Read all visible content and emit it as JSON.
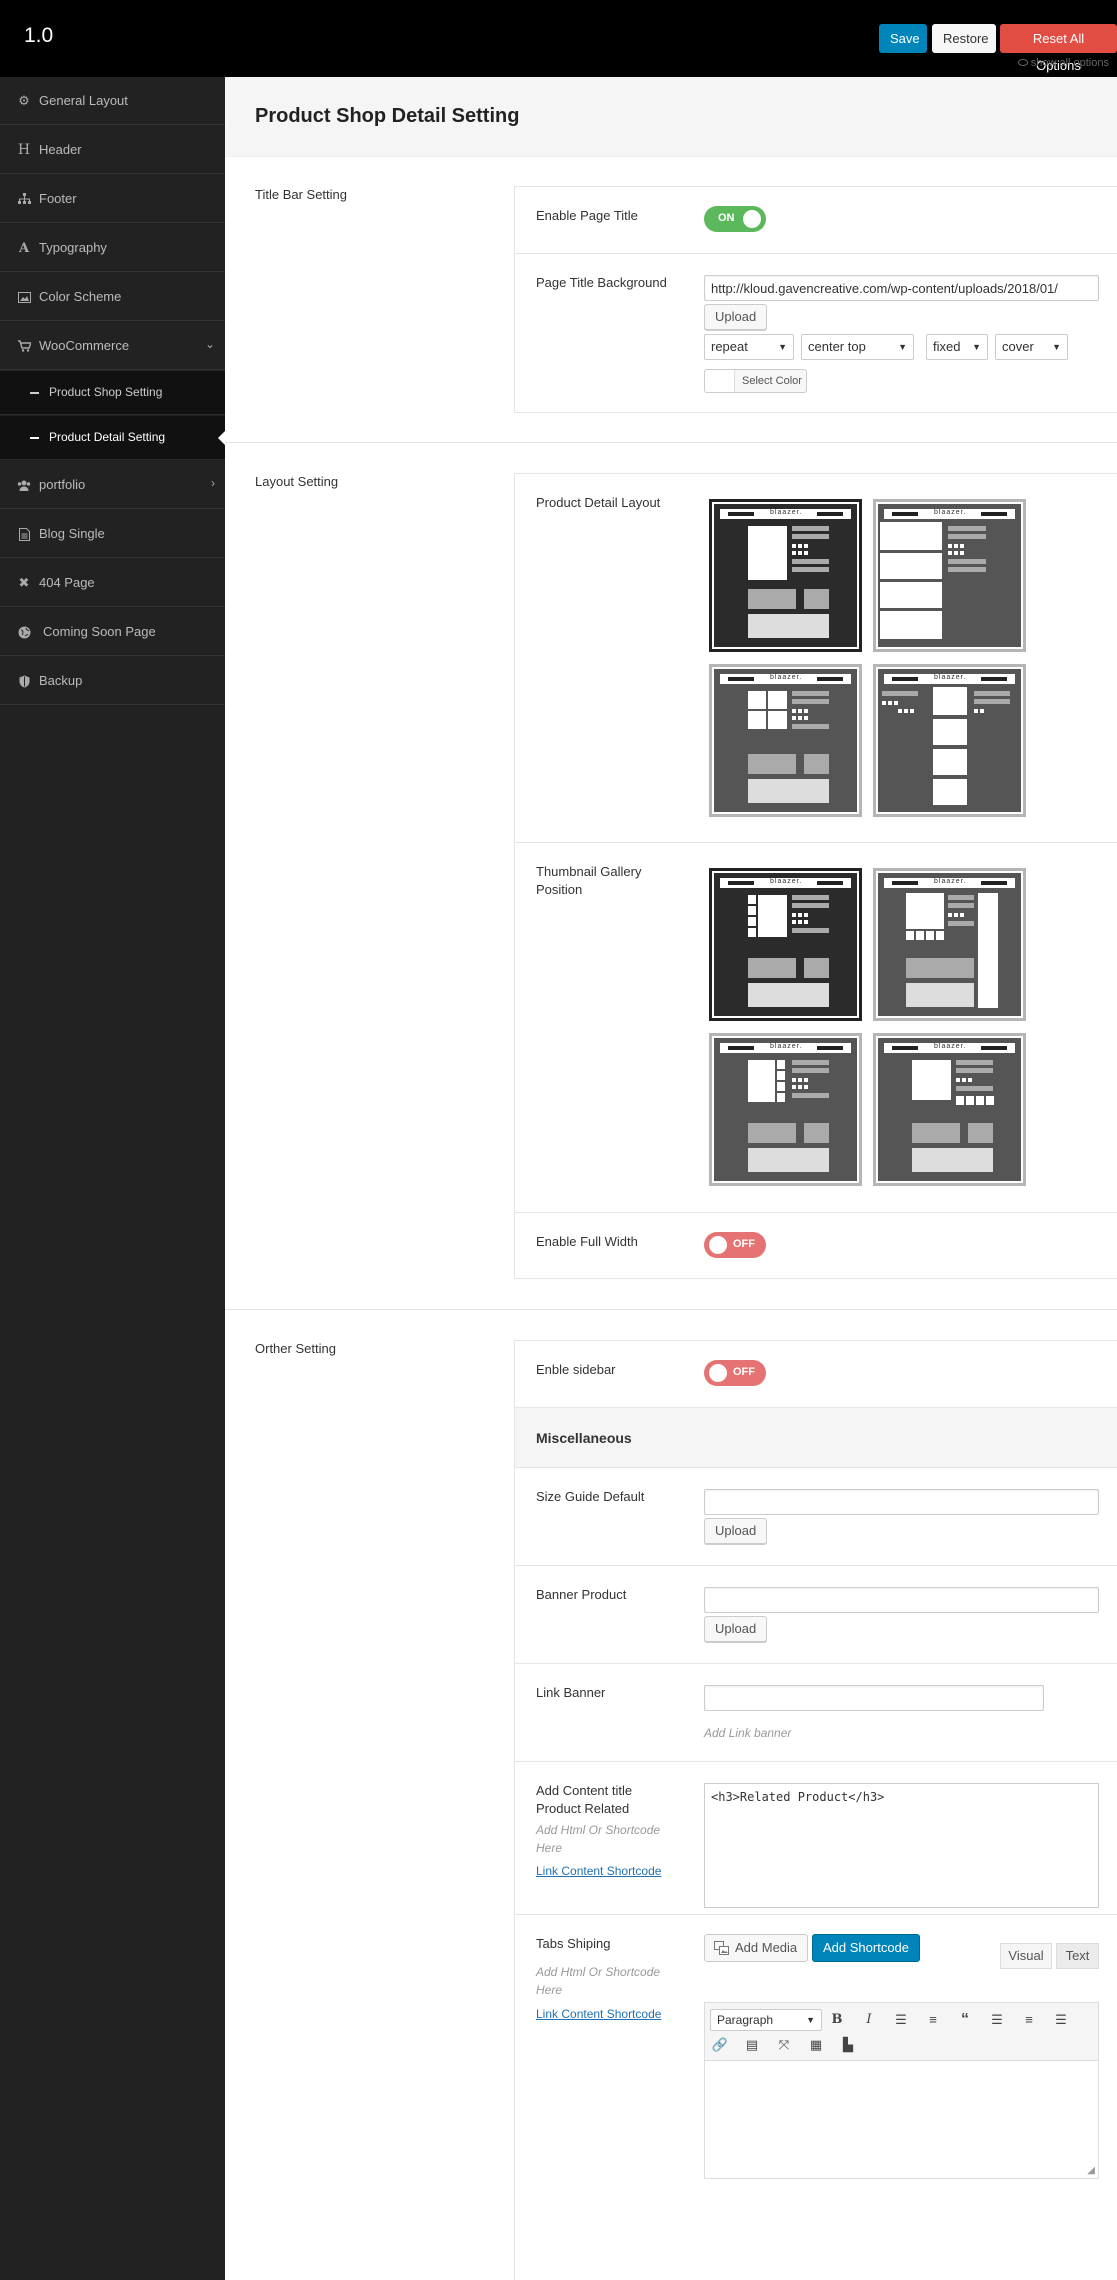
{
  "app": {
    "version": "1.0",
    "save_label": "Save",
    "restore_label": "Restore",
    "reset_label": "Reset All Options",
    "show_all_label": "show all options",
    "accent": "#0085ba",
    "danger": "#e14d43"
  },
  "sidebar": {
    "items": [
      {
        "label": "General Layout",
        "icon": "gear-icon"
      },
      {
        "label": "Header",
        "icon": "header-icon"
      },
      {
        "label": "Footer",
        "icon": "sitemap-icon"
      },
      {
        "label": "Typography",
        "icon": "font-icon"
      },
      {
        "label": "Color Scheme",
        "icon": "image-icon"
      },
      {
        "label": "WooCommerce",
        "icon": "cart-icon"
      },
      {
        "label": "portfolio",
        "icon": "users-icon"
      },
      {
        "label": "Blog Single",
        "icon": "file-icon"
      },
      {
        "label": "404 Page",
        "icon": "close-icon"
      },
      {
        "label": "Coming Soon Page",
        "icon": "globe-icon"
      },
      {
        "label": "Backup",
        "icon": "shield-icon"
      }
    ],
    "subitems": [
      {
        "label": "Product Shop Setting"
      },
      {
        "label": "Product Detail Setting",
        "active": true
      }
    ]
  },
  "page": {
    "title": "Product Shop Detail Setting"
  },
  "sections": {
    "title_bar": {
      "label": "Title Bar Setting",
      "enable_page_title": {
        "label": "Enable Page Title",
        "state": "ON"
      },
      "page_title_bg": {
        "label": "Page Title Background",
        "url": "http://kloud.gavencreative.com/wp-content/uploads/2018/01/",
        "upload_label": "Upload",
        "repeat": "repeat",
        "position": "center top",
        "attachment": "fixed",
        "size": "cover",
        "select_color_label": "Select Color"
      }
    },
    "layout": {
      "label": "Layout Setting",
      "product_detail_layout": {
        "label": "Product Detail Layout",
        "selected": 1,
        "logo_text": "blaazer."
      },
      "thumbnail_gallery": {
        "label": "Thumbnail Gallery Position",
        "selected": 1
      },
      "full_width": {
        "label": "Enable Full Width",
        "state": "OFF"
      }
    },
    "other": {
      "label": "Orther Setting",
      "sidebar": {
        "label": "Enble sidebar",
        "state": "OFF"
      },
      "misc_heading": "Miscellaneous",
      "size_guide": {
        "label": "Size Guide Default",
        "value": "",
        "upload_label": "Upload"
      },
      "banner_product": {
        "label": "Banner Product",
        "value": "",
        "upload_label": "Upload"
      },
      "link_banner": {
        "label": "Link Banner",
        "value": "",
        "hint": "Add Link banner"
      },
      "content_title": {
        "label": "Add Content title Product Related",
        "hint": "Add Html Or Shortcode Here",
        "link": "Link Content Shortcode",
        "value": "<h3>Related Product</h3>"
      },
      "tabs_shipping": {
        "label": "Tabs Shiping",
        "hint": "Add Html Or Shortcode Here",
        "link": "Link Content Shortcode",
        "add_media_label": "Add Media",
        "add_shortcode_label": "Add Shortcode",
        "visual_tab": "Visual",
        "text_tab": "Text",
        "format_select": "Paragraph"
      }
    }
  }
}
